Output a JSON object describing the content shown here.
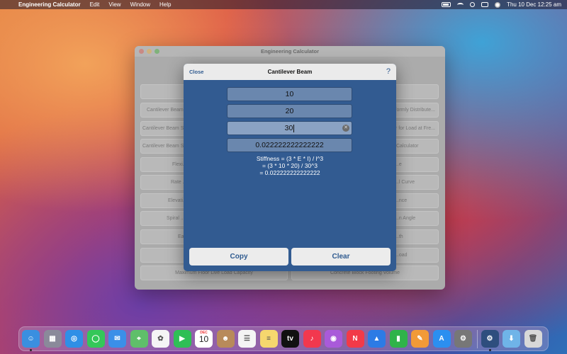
{
  "menubar": {
    "app_name": "Engineering Calculator",
    "items": [
      "Edit",
      "View",
      "Window",
      "Help"
    ],
    "datetime": "Thu 10 Dec  12:25 am"
  },
  "window": {
    "title": "Engineering Calculator",
    "background_buttons": [
      "Cantilever Beam",
      "Uniformly Distribute...",
      "Cantilever Beam Sl...",
      "...or for Load at Fre...",
      "Cantilever Beam St...",
      "Calculator",
      "Flexi...",
      "...e",
      "Rate ...",
      "...l Curve",
      "Elevati...",
      "...nce",
      "Spiral ...",
      "...n Angle",
      "Ea...",
      "...th",
      "...oad",
      "Maximum Floor Live Load Capacity",
      "Concrete Block Footing Volume"
    ]
  },
  "modal": {
    "close_label": "Close",
    "title": "Cantilever Beam",
    "help_label": "?",
    "inputs": [
      "10",
      "20",
      "30"
    ],
    "result": "0.022222222222222",
    "formula_lines": [
      "Stiffness = (3 * E * I) / l^3",
      "= (3 * 10 * 20) / 30^3",
      "= 0.022222222222222"
    ],
    "copy_label": "Copy",
    "clear_label": "Clear",
    "calendar_day": "10",
    "calendar_month": "DEC"
  },
  "dock": {
    "icons": [
      {
        "name": "finder-icon",
        "color": "#3a8fe0",
        "glyph": "☺"
      },
      {
        "name": "launchpad-icon",
        "color": "#8a8a9a",
        "glyph": "▦"
      },
      {
        "name": "safari-icon",
        "color": "#2f8fe6",
        "glyph": "◎"
      },
      {
        "name": "messages-icon",
        "color": "#34c759",
        "glyph": "◯"
      },
      {
        "name": "mail-icon",
        "color": "#3b8fe8",
        "glyph": "✉"
      },
      {
        "name": "maps-icon",
        "color": "#5fbf6a",
        "glyph": "⌖"
      },
      {
        "name": "photos-icon",
        "color": "#f5f5f5",
        "glyph": "✿"
      },
      {
        "name": "facetime-icon",
        "color": "#2fbf56",
        "glyph": "▶"
      },
      {
        "name": "calendar-icon",
        "color": "#ffffff",
        "glyph": ""
      },
      {
        "name": "contacts-icon",
        "color": "#b88a5a",
        "glyph": "☻"
      },
      {
        "name": "reminders-icon",
        "color": "#f4f4f4",
        "glyph": "☰"
      },
      {
        "name": "notes-icon",
        "color": "#f5d76e",
        "glyph": "≡"
      },
      {
        "name": "tv-icon",
        "color": "#111111",
        "glyph": "tv"
      },
      {
        "name": "music-icon",
        "color": "#f2384e",
        "glyph": "♪"
      },
      {
        "name": "podcasts-icon",
        "color": "#a95ad9",
        "glyph": "◉"
      },
      {
        "name": "news-icon",
        "color": "#f23a48",
        "glyph": "N"
      },
      {
        "name": "keynote-icon",
        "color": "#2c7be5",
        "glyph": "▲"
      },
      {
        "name": "numbers-icon",
        "color": "#2fb34a",
        "glyph": "▮"
      },
      {
        "name": "pages-icon",
        "color": "#f29a38",
        "glyph": "✎"
      },
      {
        "name": "app-store-icon",
        "color": "#2b8ff0",
        "glyph": "A"
      },
      {
        "name": "system-preferences-icon",
        "color": "#777777",
        "glyph": "⚙"
      },
      {
        "name": "engineering-calculator-icon",
        "color": "#2e4e7e",
        "glyph": "⚙"
      },
      {
        "name": "downloads-folder-icon",
        "color": "#6fb4e8",
        "glyph": "⬇"
      },
      {
        "name": "trash-icon",
        "color": "#d8d8d8",
        "glyph": "🗑"
      }
    ]
  }
}
